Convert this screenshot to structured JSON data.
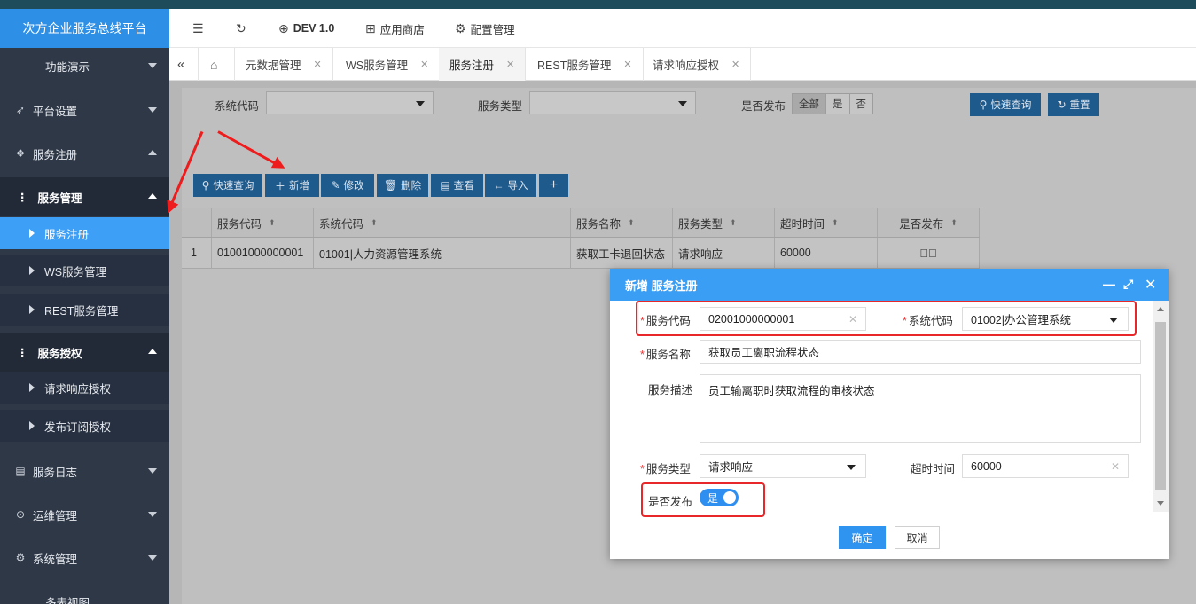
{
  "app": {
    "title": "次方企业服务总线平台"
  },
  "sidebar": {
    "items": [
      {
        "label": "功能演示",
        "icon": "none"
      },
      {
        "label": "平台设置",
        "icon": "send-icon"
      },
      {
        "label": "服务注册",
        "icon": "cubes-icon"
      }
    ],
    "group_manage": {
      "label": "服务管理"
    },
    "sub_manage": [
      {
        "label": "服务注册"
      },
      {
        "label": "WS服务管理"
      },
      {
        "label": "REST服务管理"
      }
    ],
    "group_auth": {
      "label": "服务授权"
    },
    "sub_auth": [
      {
        "label": "请求响应授权"
      },
      {
        "label": "发布订阅授权"
      }
    ],
    "bottom_items": [
      {
        "label": "服务日志",
        "icon": "file-icon"
      },
      {
        "label": "运维管理",
        "icon": "play-circle-icon"
      },
      {
        "label": "系统管理",
        "icon": "gear-icon"
      },
      {
        "label": "多表视图",
        "icon": "none"
      }
    ]
  },
  "topbar": {
    "env_label": "DEV 1.0",
    "app_store_label": "应用商店",
    "config_label": "配置管理"
  },
  "tabs": [
    {
      "label": "元数据管理"
    },
    {
      "label": "WS服务管理"
    },
    {
      "label": "服务注册"
    },
    {
      "label": "REST服务管理"
    },
    {
      "label": "请求响应授权"
    }
  ],
  "filters": {
    "system_code_label": "系统代码",
    "service_type_label": "服务类型",
    "published_label": "是否发布",
    "published_options": [
      "全部",
      "是",
      "否"
    ],
    "published_selected": "全部",
    "quick_query_label": "快速查询",
    "reset_label": "重置"
  },
  "toolbar": {
    "quick_query": "快速查询",
    "add": "新增",
    "edit": "修改",
    "delete": "删除",
    "view": "查看",
    "import": "导入",
    "more": "+"
  },
  "table": {
    "columns": [
      "服务代码",
      "系统代码",
      "服务名称",
      "服务类型",
      "超时时间",
      "是否发布"
    ],
    "rows": [
      {
        "index": "1",
        "service_code": "01001000000001",
        "system_code": "01001|人力资源管理系统",
        "service_name": "获取工卡退回状态",
        "service_type": "请求响应",
        "timeout": "60000",
        "published": "check-circle-icon"
      }
    ]
  },
  "modal": {
    "title": "新增 服务注册",
    "service_code_label": "服务代码",
    "service_code_value": "02001000000001",
    "system_code_label": "系统代码",
    "system_code_value": "01002|办公管理系统",
    "service_name_label": "服务名称",
    "service_name_value": "获取员工离职流程状态",
    "service_desc_label": "服务描述",
    "service_desc_value": "员工输离职时获取流程的审核状态",
    "service_type_label": "服务类型",
    "service_type_value": "请求响应",
    "timeout_label": "超时时间",
    "timeout_value": "60000",
    "published_label": "是否发布",
    "published_value": "是",
    "confirm_label": "确定",
    "cancel_label": "取消"
  },
  "colors": {
    "brand": "#2d8fe6",
    "sidebar_bg": "#2f3847",
    "active_item": "#3d9ff6",
    "annotation_red": "#e8272a"
  }
}
